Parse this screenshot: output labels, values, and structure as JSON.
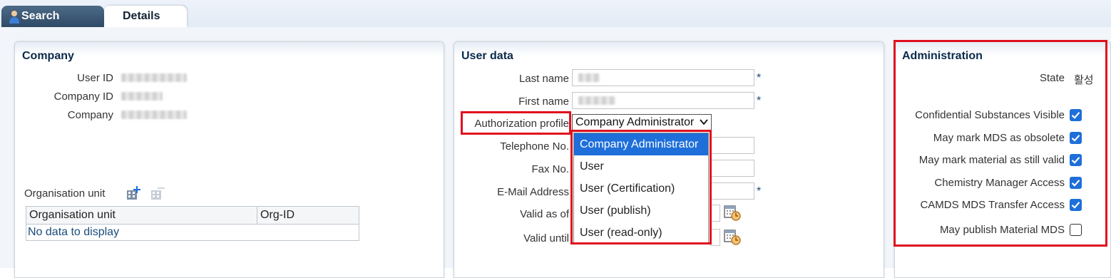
{
  "tabs": {
    "search": "Search",
    "details": "Details"
  },
  "company_panel": {
    "title": "Company",
    "labels": {
      "user_id": "User ID",
      "company_id": "Company ID",
      "company": "Company"
    },
    "org_unit_label": "Organisation unit",
    "table": {
      "columns": [
        "Organisation unit",
        "Org-ID"
      ],
      "empty_text": "No data to display"
    }
  },
  "user_panel": {
    "title": "User data",
    "labels": {
      "last_name": "Last name",
      "first_name": "First name",
      "auth_profile": "Authorization profile",
      "telephone": "Telephone No.",
      "fax": "Fax No.",
      "email": "E-Mail Address",
      "valid_as_of": "Valid as of",
      "valid_until": "Valid until"
    },
    "required_mark": "*",
    "auth_profile_selected": "Company Administrator",
    "auth_profile_options": [
      "Company Administrator",
      "User",
      "User (Certification)",
      "User (publish)",
      "User (read-only)"
    ]
  },
  "admin_panel": {
    "title": "Administration",
    "state_label": "State",
    "state_value": "활성",
    "permissions": [
      {
        "label": "Confidential Substances Visible",
        "checked": true
      },
      {
        "label": "May mark MDS as obsolete",
        "checked": true
      },
      {
        "label": "May mark material as still valid",
        "checked": true
      },
      {
        "label": "Chemistry Manager Access",
        "checked": true
      },
      {
        "label": "CAMDS MDS Transfer Access",
        "checked": true
      },
      {
        "label": "May publish Material MDS",
        "checked": false
      }
    ]
  },
  "colors": {
    "highlight": "#e0101e",
    "accent": "#1e6fd9",
    "title": "#0b2a4a"
  },
  "icons": {
    "search_tab": "user-icon",
    "org_add": "building-add-icon",
    "org_remove": "building-remove-icon",
    "calendar": "calendar-clock-icon",
    "select_arrow": "chevron-down-icon"
  }
}
